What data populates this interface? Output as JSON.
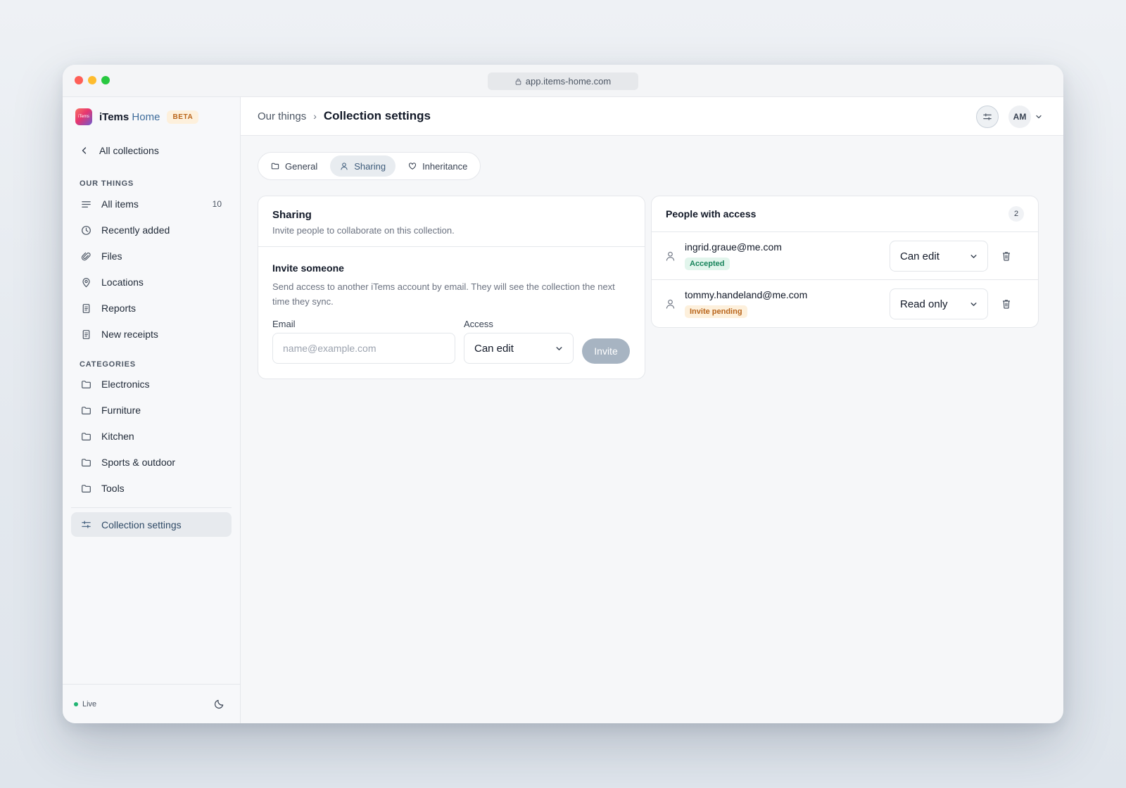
{
  "browser": {
    "url": "app.items-home.com"
  },
  "brand": {
    "logo_text": "iTems",
    "name_main": "iTems",
    "name_accent": "Home",
    "badge": "BETA"
  },
  "sidebar": {
    "back_label": "All collections",
    "section_our_things": "OUR THINGS",
    "nav": [
      {
        "label": "All items",
        "icon": "list-icon",
        "count": "10"
      },
      {
        "label": "Recently added",
        "icon": "clock-icon"
      },
      {
        "label": "Files",
        "icon": "paperclip-icon"
      },
      {
        "label": "Locations",
        "icon": "map-pin-icon"
      },
      {
        "label": "Reports",
        "icon": "document-icon"
      },
      {
        "label": "New receipts",
        "icon": "receipt-icon"
      }
    ],
    "section_categories": "CATEGORIES",
    "categories": [
      {
        "label": "Electronics",
        "icon": "folder-icon"
      },
      {
        "label": "Furniture",
        "icon": "folder-icon"
      },
      {
        "label": "Kitchen",
        "icon": "folder-icon"
      },
      {
        "label": "Sports & outdoor",
        "icon": "folder-icon"
      },
      {
        "label": "Tools",
        "icon": "folder-icon"
      }
    ],
    "active_item": {
      "label": "Collection settings",
      "icon": "sliders-icon"
    },
    "status": "Live"
  },
  "header": {
    "breadcrumb_parent": "Our things",
    "breadcrumb_separator": "›",
    "breadcrumb_current": "Collection settings",
    "avatar_initials": "AM"
  },
  "tabs": [
    {
      "label": "General",
      "icon": "folder-icon",
      "active": false
    },
    {
      "label": "Sharing",
      "icon": "user-icon",
      "active": true
    },
    {
      "label": "Inheritance",
      "icon": "heart-icon",
      "active": false
    }
  ],
  "sharing": {
    "title": "Sharing",
    "subtitle": "Invite people to collaborate on this collection.",
    "invite_title": "Invite someone",
    "invite_desc": "Send access to another iTems account by email. They will see the collection the next time they sync.",
    "email_label": "Email",
    "email_placeholder": "name@example.com",
    "email_value": "",
    "access_label": "Access",
    "access_value": "Can edit",
    "invite_button": "Invite"
  },
  "people": {
    "title": "People with access",
    "count": "2",
    "list": [
      {
        "email": "ingrid.graue@me.com",
        "status": "Accepted",
        "status_kind": "ok",
        "access": "Can edit"
      },
      {
        "email": "tommy.handeland@me.com",
        "status": "Invite pending",
        "status_kind": "pending",
        "access": "Read only"
      }
    ]
  },
  "colors": {
    "accent": "#3d5b7a",
    "live_green": "#22b573",
    "accepted_green": "#17835a",
    "pending_orange": "#b9651b",
    "invite_button_disabled": "#a7b4c2"
  }
}
